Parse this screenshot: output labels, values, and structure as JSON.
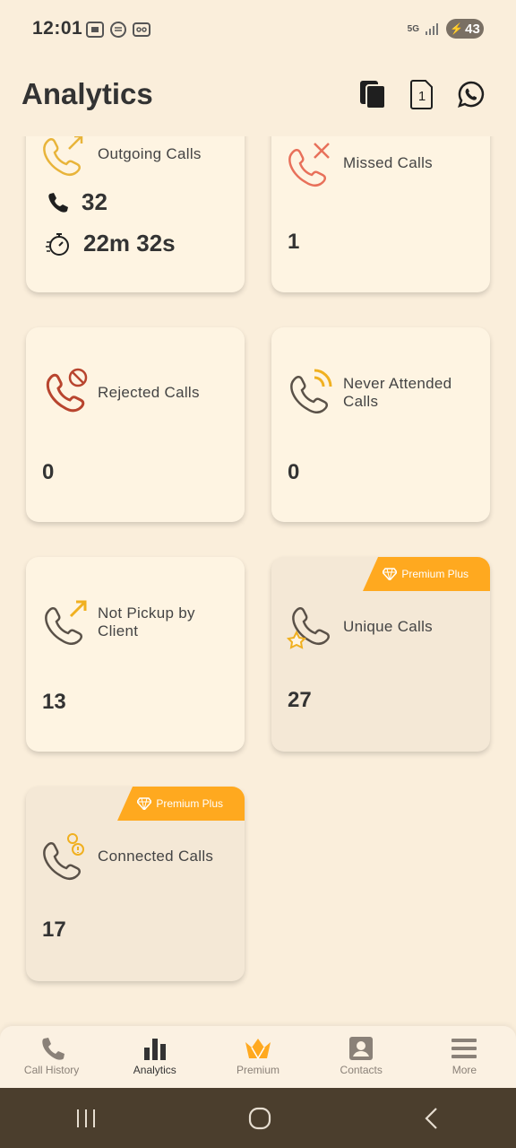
{
  "status_bar": {
    "time": "12:01",
    "network": "5G",
    "battery": "43"
  },
  "app_bar": {
    "title": "Analytics"
  },
  "cards": {
    "outgoing": {
      "label": "Outgoing Calls",
      "count": "32",
      "duration": "22m 32s"
    },
    "missed": {
      "label": "Missed Calls",
      "value": "1"
    },
    "rejected": {
      "label": "Rejected Calls",
      "value": "0"
    },
    "never_attended": {
      "label": "Never Attended Calls",
      "value": "0"
    },
    "not_pickup": {
      "label": "Not Pickup by Client",
      "value": "13"
    },
    "unique": {
      "label": "Unique Calls",
      "value": "27",
      "tag": "Premium Plus"
    },
    "connected": {
      "label": "Connected Calls",
      "value": "17",
      "tag": "Premium Plus"
    }
  },
  "bottom_nav": [
    {
      "label": "Call History",
      "icon": "phone-icon"
    },
    {
      "label": "Analytics",
      "icon": "bar-chart-icon",
      "active": true
    },
    {
      "label": "Premium",
      "icon": "crown-icon"
    },
    {
      "label": "Contacts",
      "icon": "contact-card-icon"
    },
    {
      "label": "More",
      "icon": "menu-icon"
    }
  ],
  "colors": {
    "background": "#FAEEDB",
    "card": "#FEF4E2",
    "premium_card": "#F4E8D6",
    "accent": "#FFA91F",
    "missed": "#E8705A",
    "rejected": "#B8442E",
    "system_nav": "#4B3E2D"
  }
}
